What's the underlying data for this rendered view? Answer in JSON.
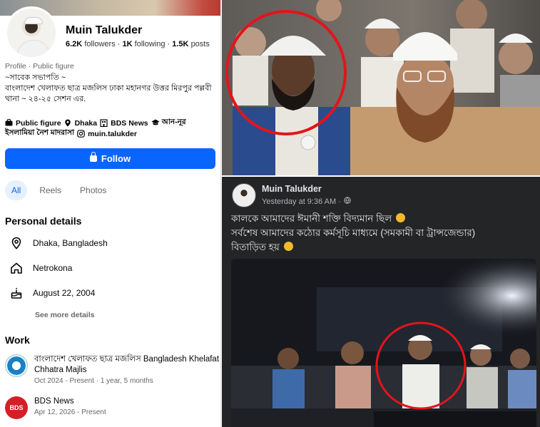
{
  "profile": {
    "name": "Muin Talukder",
    "followers_count": "6.2K",
    "followers_label": "followers",
    "following_count": "1K",
    "following_label": "following",
    "posts_count": "1.5K",
    "posts_label": "posts",
    "category": "Profile · Public figure",
    "bio_line1": "~সাবেক সভাপতি ~",
    "bio_line2": "বাংলাদেশ খেলাফত ছাত্র মজলিস ঢাকা মহানগর উত্তর মিরপুর পল্লবী থানা ~ ২৪-২৫ সেশন এর.",
    "intro": {
      "public_figure": "Public figure",
      "location": "Dhaka",
      "bds_news": "BDS News",
      "school_prefix": "আন-নূর",
      "school_rest": "ইসলামিয়া নৈশ মাদরাসা",
      "instagram": "muin.talukder"
    },
    "follow_label": "Follow",
    "tabs": [
      "All",
      "Reels",
      "Photos"
    ],
    "personal_title": "Personal details",
    "details": {
      "city": "Dhaka, Bangladesh",
      "hometown": "Netrokona",
      "birthday": "August 22, 2004"
    },
    "see_more": "See more details",
    "work_title": "Work",
    "work": [
      {
        "title": "বাংলাদেশ খেলাফত ছাত্র মজলিস Bangladesh Khelafat Chhatra Majlis",
        "sub": "Oct 2024 - Present · 1 year, 5 months"
      },
      {
        "title": "BDS News",
        "sub": "Apr 12, 2026 - Present",
        "logo_text": "BDS"
      }
    ]
  },
  "post": {
    "author": "Muin Talukder",
    "time": "Yesterday at 9:36 AM ·",
    "line1": "কালকে আমাদের ঈমানী শক্তি বিদ্যমান ছিল",
    "line2": "সর্বশেষ আমাদের কঠোর কর্মসূচি মাধ্যমে (সমকামী বা ট্রান্সজেন্ডার)",
    "line3": "বিতাড়িত হয়"
  },
  "colors": {
    "accent": "#0866ff",
    "highlight_circle": "#e3141b",
    "post_bg": "#242526"
  }
}
